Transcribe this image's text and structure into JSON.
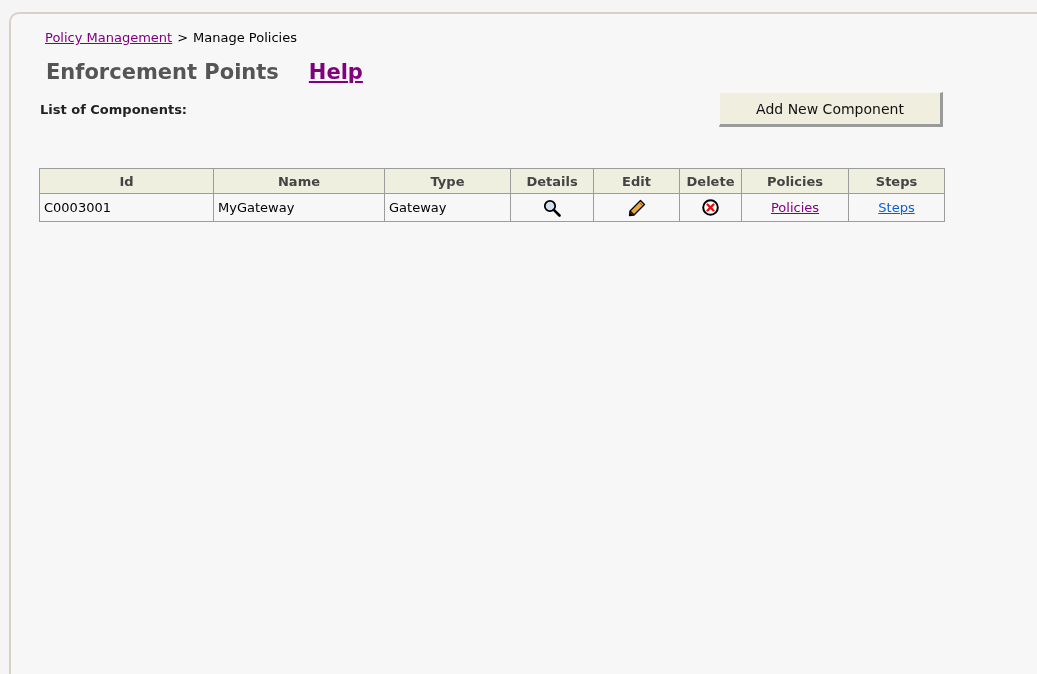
{
  "breadcrumb": {
    "link": {
      "text": "Policy Management",
      "visited": true
    },
    "separator": ">",
    "current": "Manage Policies"
  },
  "title": "Enforcement Points",
  "help_link": {
    "text": "Help",
    "visited": true
  },
  "list_label": "List of Components:",
  "add_button": "Add New Component",
  "table": {
    "columns": [
      "Id",
      "Name",
      "Type",
      "Details",
      "Edit",
      "Delete",
      "Policies",
      "Steps"
    ],
    "rows": [
      {
        "cells": [
          {
            "kind": "text",
            "text": "C0003001"
          },
          {
            "kind": "text",
            "text": "MyGateway"
          },
          {
            "kind": "text",
            "text": "Gateway"
          },
          {
            "kind": "details"
          },
          {
            "kind": "edit"
          },
          {
            "kind": "delete"
          },
          {
            "kind": "link",
            "text": "Policies",
            "visited": true
          },
          {
            "kind": "link",
            "text": "Steps",
            "visited": false
          }
        ]
      }
    ]
  }
}
